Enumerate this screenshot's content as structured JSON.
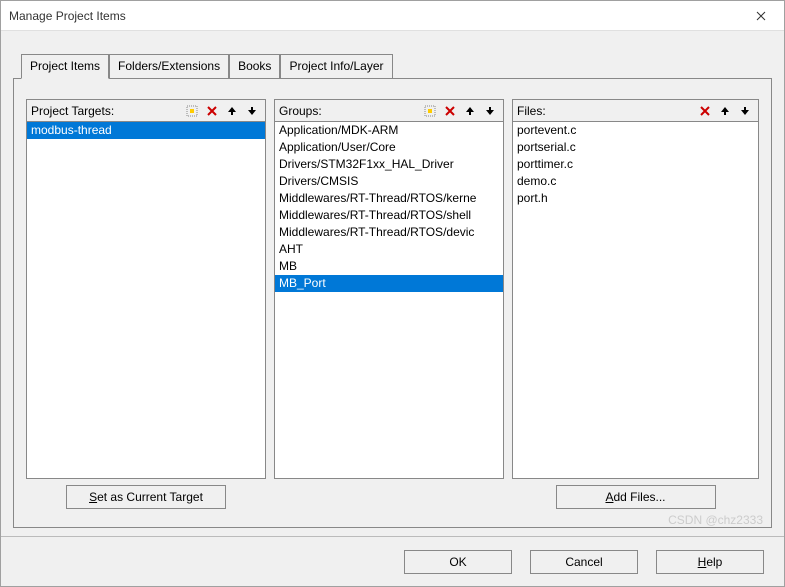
{
  "window": {
    "title": "Manage Project Items"
  },
  "tabs": {
    "items": [
      {
        "label": "Project Items"
      },
      {
        "label": "Folders/Extensions"
      },
      {
        "label": "Books"
      },
      {
        "label": "Project Info/Layer"
      }
    ]
  },
  "columns": {
    "targets": {
      "label": "Project Targets:",
      "items": [
        {
          "label": "modbus-thread"
        }
      ],
      "selected_index": 0,
      "button_label_prefix": "S",
      "button_label_suffix": "et as Current Target"
    },
    "groups": {
      "label": "Groups:",
      "items": [
        {
          "label": "Application/MDK-ARM"
        },
        {
          "label": "Application/User/Core"
        },
        {
          "label": "Drivers/STM32F1xx_HAL_Driver"
        },
        {
          "label": "Drivers/CMSIS"
        },
        {
          "label": "Middlewares/RT-Thread/RTOS/kerne"
        },
        {
          "label": "Middlewares/RT-Thread/RTOS/shell"
        },
        {
          "label": "Middlewares/RT-Thread/RTOS/devic"
        },
        {
          "label": "AHT"
        },
        {
          "label": "MB"
        },
        {
          "label": "MB_Port"
        }
      ],
      "selected_index": 9
    },
    "files": {
      "label": "Files:",
      "items": [
        {
          "label": "portevent.c"
        },
        {
          "label": "portserial.c"
        },
        {
          "label": "porttimer.c"
        },
        {
          "label": "demo.c"
        },
        {
          "label": "port.h"
        }
      ],
      "selected_index": -1,
      "button_label_prefix": "A",
      "button_label_suffix": "dd Files..."
    }
  },
  "buttons": {
    "ok": "OK",
    "cancel": "Cancel",
    "help_prefix": "H",
    "help_suffix": "elp"
  },
  "watermark": "CSDN @chz2333"
}
